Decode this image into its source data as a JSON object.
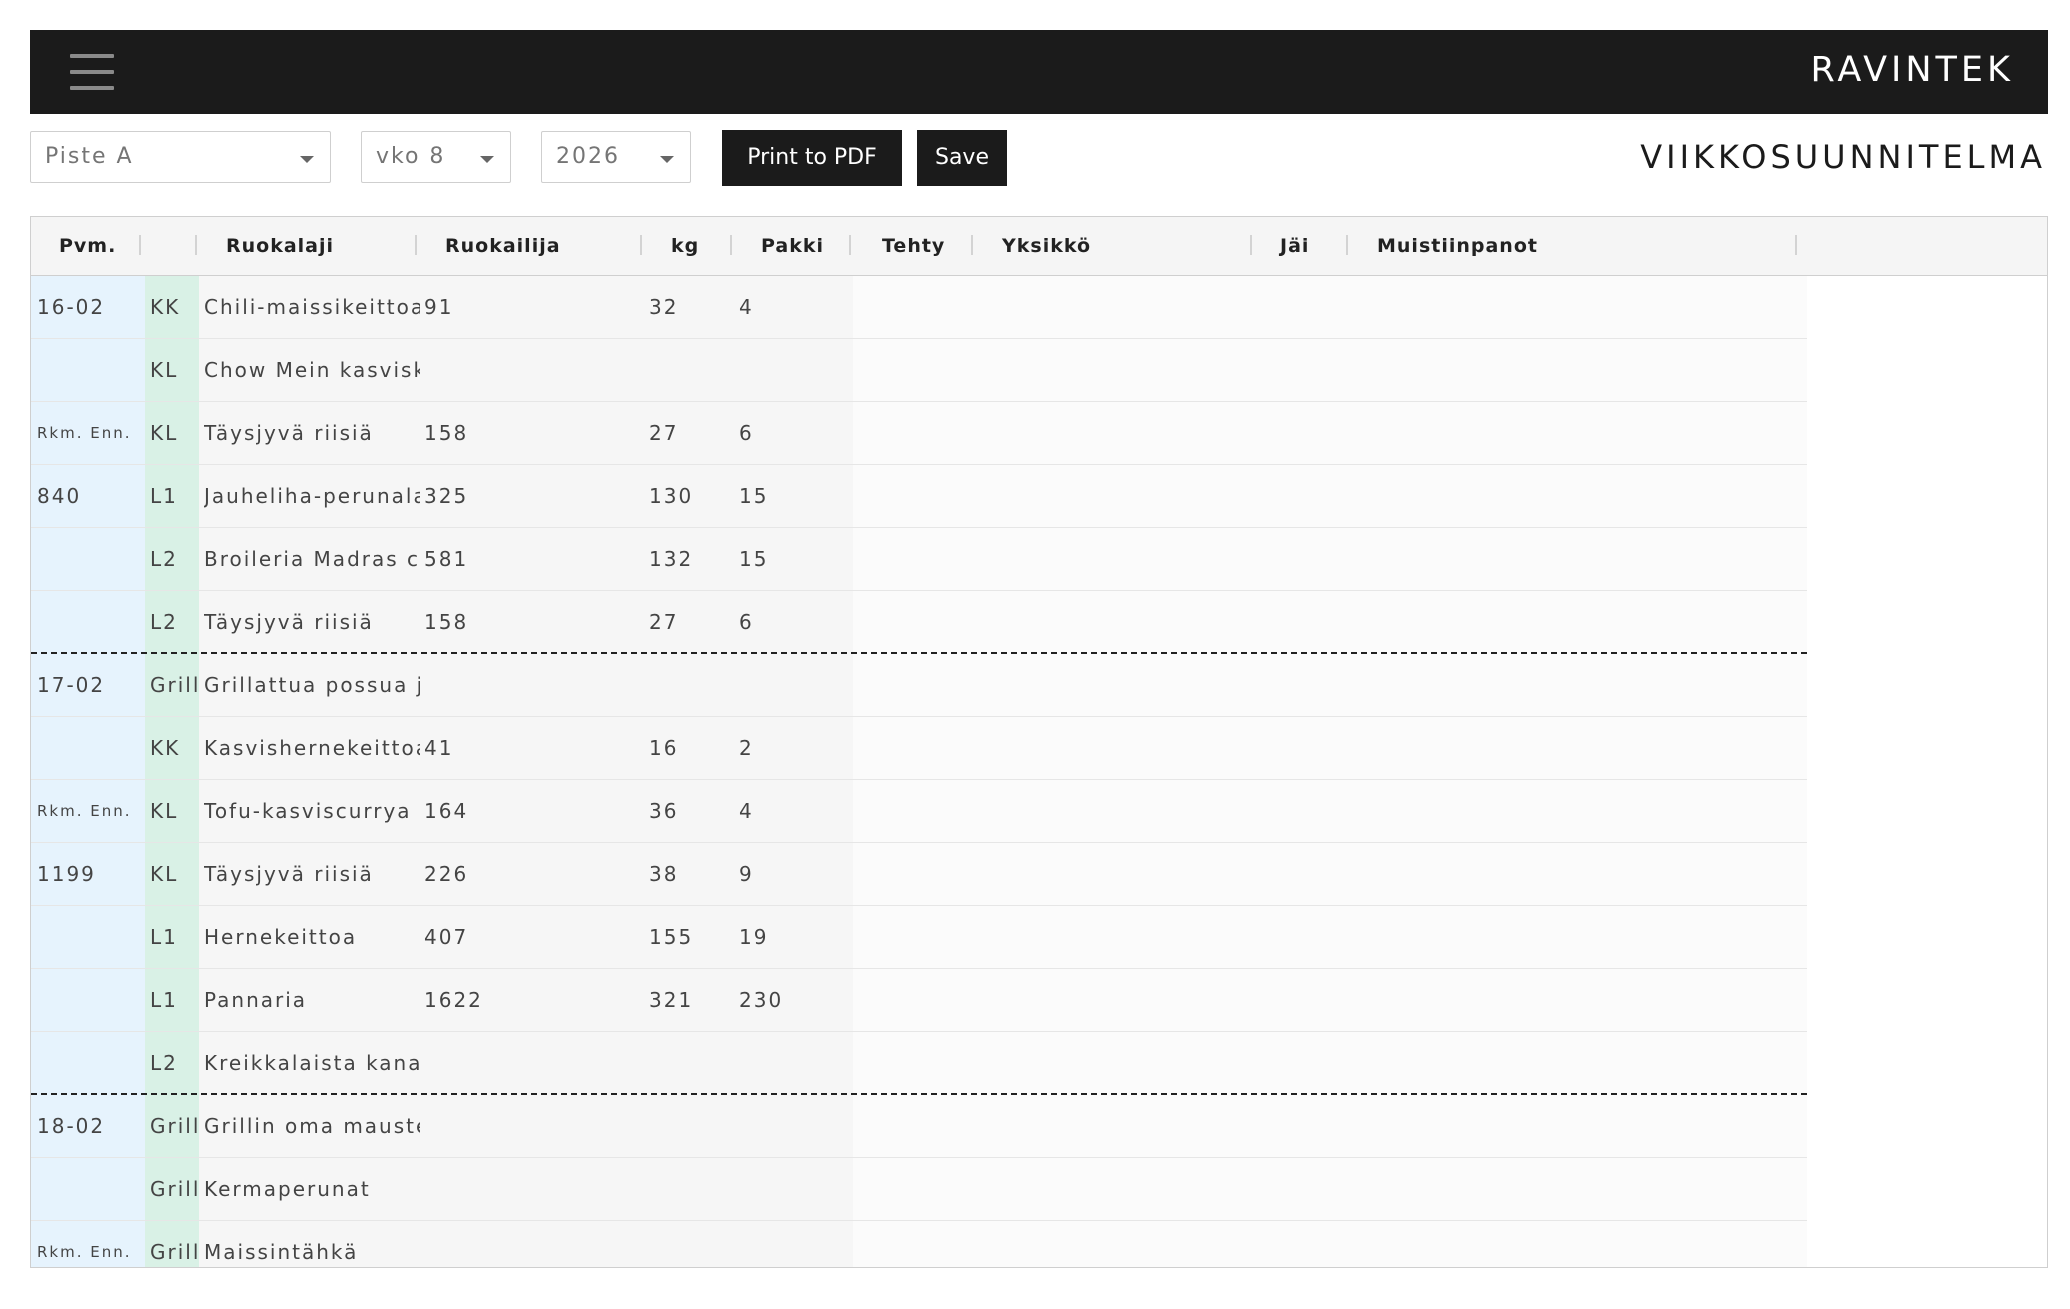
{
  "app": {
    "brand": "RAVINTEK"
  },
  "toolbar": {
    "location_select": "Piste A",
    "week_select": "vko 8",
    "year_select": "2026",
    "print_label": "Print to PDF",
    "save_label": "Save",
    "page_title": "VIIKKOSUUNNITELMA"
  },
  "table": {
    "headers": {
      "pvm": "Pvm.",
      "ruokalaji": "Ruokalaji",
      "ruokailija": "Ruokailija",
      "kg": "kg",
      "pakki": "Pakki",
      "tehty": "Tehty",
      "yksikko": "Yksikkö",
      "jai": "Jäi",
      "muistiinpanot": "Muistiinpanot"
    },
    "rows": [
      {
        "pvm": "16-02",
        "typ": "KK",
        "ruoka": "Chili-maissikeittoa",
        "syo": "91",
        "kg": "32",
        "pak": "4"
      },
      {
        "pvm": "",
        "typ": "KL",
        "ruoka": "Chow Mein kasviskastiketta",
        "syo": "",
        "kg": "",
        "pak": ""
      },
      {
        "pvm": "Rkm. Enn.",
        "typ": "KL",
        "ruoka": "Täysjyvä riisiä",
        "syo": "158",
        "kg": "27",
        "pak": "6"
      },
      {
        "pvm": "840",
        "typ": "L1",
        "ruoka": "Jauheliha-perunalaatikkoa",
        "syo": "325",
        "kg": "130",
        "pak": "15"
      },
      {
        "pvm": "",
        "typ": "L2",
        "ruoka": "Broileria Madras chili",
        "syo": "581",
        "kg": "132",
        "pak": "15"
      },
      {
        "pvm": "",
        "typ": "L2",
        "ruoka": "Täysjyvä riisiä",
        "syo": "158",
        "kg": "27",
        "pak": "6"
      },
      {
        "pvm": "17-02",
        "typ": "Grill",
        "ruoka": "Grillattua possua ja",
        "syo": "",
        "kg": "",
        "pak": ""
      },
      {
        "pvm": "",
        "typ": "KK",
        "ruoka": "Kasvishernekeittoa",
        "syo": "41",
        "kg": "16",
        "pak": "2"
      },
      {
        "pvm": "Rkm. Enn.",
        "typ": "KL",
        "ruoka": "Tofu-kasviscurrya",
        "syo": "164",
        "kg": "36",
        "pak": "4"
      },
      {
        "pvm": "1199",
        "typ": "KL",
        "ruoka": "Täysjyvä riisiä",
        "syo": "226",
        "kg": "38",
        "pak": "9"
      },
      {
        "pvm": "",
        "typ": "L1",
        "ruoka": "Hernekeittoa",
        "syo": "407",
        "kg": "155",
        "pak": "19"
      },
      {
        "pvm": "",
        "typ": "L1",
        "ruoka": "Pannaria",
        "syo": "1622",
        "kg": "321",
        "pak": "230"
      },
      {
        "pvm": "",
        "typ": "L2",
        "ruoka": "Kreikkalaista kanaa",
        "syo": "",
        "kg": "",
        "pak": ""
      },
      {
        "pvm": "18-02",
        "typ": "Grill",
        "ruoka": "Grillin oma mauste",
        "syo": "",
        "kg": "",
        "pak": ""
      },
      {
        "pvm": "",
        "typ": "Grill",
        "ruoka": "Kermaperunat",
        "syo": "",
        "kg": "",
        "pak": ""
      },
      {
        "pvm": "Rkm. Enn.",
        "typ": "Grill",
        "ruoka": "Maissintähkä",
        "syo": "",
        "kg": "",
        "pak": ""
      }
    ]
  }
}
